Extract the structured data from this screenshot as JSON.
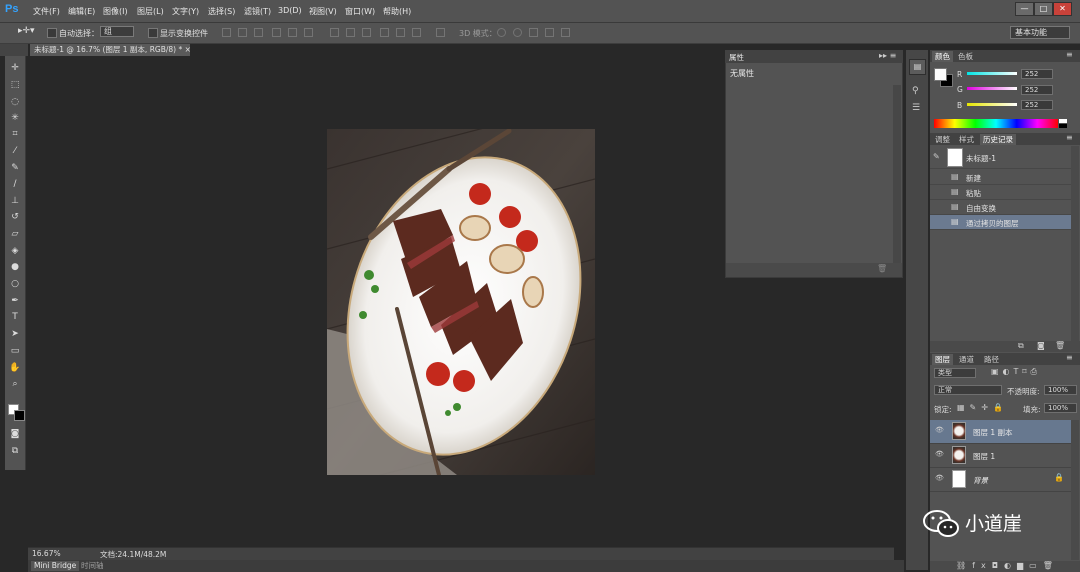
{
  "app": {
    "logo": "Ps"
  },
  "menu": [
    "文件(F)",
    "编辑(E)",
    "图像(I)",
    "图层(L)",
    "文字(Y)",
    "选择(S)",
    "滤镜(T)",
    "3D(D)",
    "视图(V)",
    "窗口(W)",
    "帮助(H)"
  ],
  "window_controls": {
    "minimize": "—",
    "restore": "□",
    "close": "✕"
  },
  "options": {
    "auto_select_label": "自动选择：",
    "auto_select_value": "组",
    "show_transform_label": "显示变换控件",
    "mode3d_label": "3D 模式：",
    "workspace": "基本功能"
  },
  "document": {
    "tab_title": "未标题-1 @ 16.7% (图层 1 副本, RGB/8) *",
    "tab_close": "×"
  },
  "status": {
    "zoom": "16.67%",
    "doc_size": "文档:24.1M/48.2M"
  },
  "bottom_tabs": [
    "Mini Bridge",
    "时间轴"
  ],
  "properties_panel": {
    "title": "属性",
    "content": "无属性"
  },
  "color_panel": {
    "tabs": [
      "颜色",
      "色板"
    ],
    "channels": [
      {
        "label": "R",
        "value": "252",
        "color": "#00e5e5"
      },
      {
        "label": "G",
        "value": "252",
        "color": "#e000e0"
      },
      {
        "label": "B",
        "value": "252",
        "color": "#e6e600"
      }
    ]
  },
  "history_panel": {
    "tabs": [
      "调整",
      "样式",
      "历史记录"
    ],
    "snapshot": "未标题-1",
    "items": [
      "新建",
      "粘贴",
      "自由变换",
      "通过拷贝的图层"
    ]
  },
  "layers_panel": {
    "tabs": [
      "图层",
      "通道",
      "路径"
    ],
    "kind_filter": "类型",
    "blend_mode": "正常",
    "opacity_label": "不透明度:",
    "opacity_value": "100%",
    "lock_label": "锁定:",
    "fill_label": "填充:",
    "fill_value": "100%",
    "layers": [
      {
        "name": "图层 1 副本",
        "selected": true
      },
      {
        "name": "图层 1",
        "selected": false
      },
      {
        "name": "背景",
        "selected": false
      }
    ]
  },
  "watermark": {
    "text": "小道崖"
  }
}
